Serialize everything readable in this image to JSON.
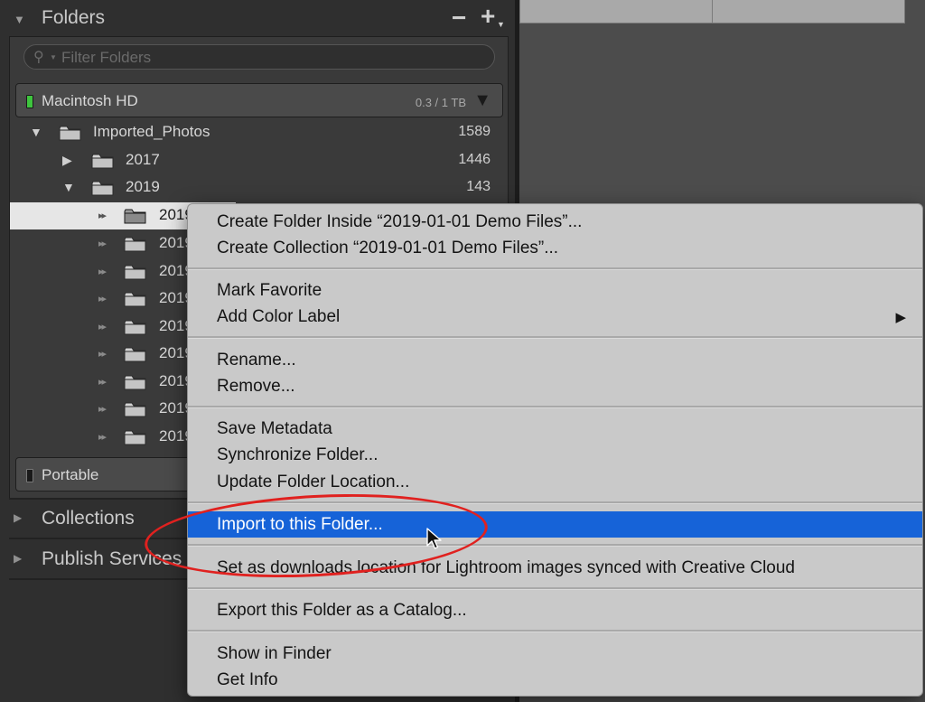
{
  "folders_panel": {
    "title": "Folders",
    "minus_symbol": "−",
    "plus_symbol": "+",
    "filter_placeholder": "Filter Folders",
    "volumes": [
      {
        "name": "Macintosh HD",
        "size": "0.3 / 1 TB",
        "status_color": "#3ec43e"
      },
      {
        "name": "Portable",
        "size": "",
        "status_color": "#1a1a1a"
      }
    ],
    "tree": [
      {
        "label": "Imported_Photos",
        "count": "1589",
        "expanded": true
      },
      {
        "label": "2017",
        "count": "1446",
        "expanded": false
      },
      {
        "label": "2019",
        "count": "143",
        "expanded": true
      },
      {
        "label": "2019",
        "count": "",
        "selected": true
      },
      {
        "label": "2019",
        "count": ""
      },
      {
        "label": "2019",
        "count": ""
      },
      {
        "label": "2019",
        "count": ""
      },
      {
        "label": "2019",
        "count": ""
      },
      {
        "label": "2019",
        "count": ""
      },
      {
        "label": "2019",
        "count": ""
      },
      {
        "label": "2019",
        "count": ""
      },
      {
        "label": "2019",
        "count": ""
      }
    ]
  },
  "sections": [
    {
      "title": "Collections"
    },
    {
      "title": "Publish Services"
    }
  ],
  "context_menu": {
    "groups": [
      [
        "Create Folder Inside “2019-01-01 Demo Files”...",
        "Create Collection “2019-01-01 Demo Files”..."
      ],
      [
        "Mark Favorite",
        "Add Color Label"
      ],
      [
        "Rename...",
        "Remove..."
      ],
      [
        "Save Metadata",
        "Synchronize Folder...",
        "Update Folder Location..."
      ],
      [
        "Import to this Folder..."
      ],
      [
        "Set as downloads location for Lightroom images synced with Creative Cloud"
      ],
      [
        "Export this Folder as a Catalog..."
      ],
      [
        "Show in Finder",
        "Get Info"
      ]
    ],
    "highlighted_item": "Import to this Folder...",
    "submenu_item": "Add Color Label",
    "highlight_color": "#1663d8"
  },
  "annotation": {
    "oval_color": "#e0211f"
  }
}
